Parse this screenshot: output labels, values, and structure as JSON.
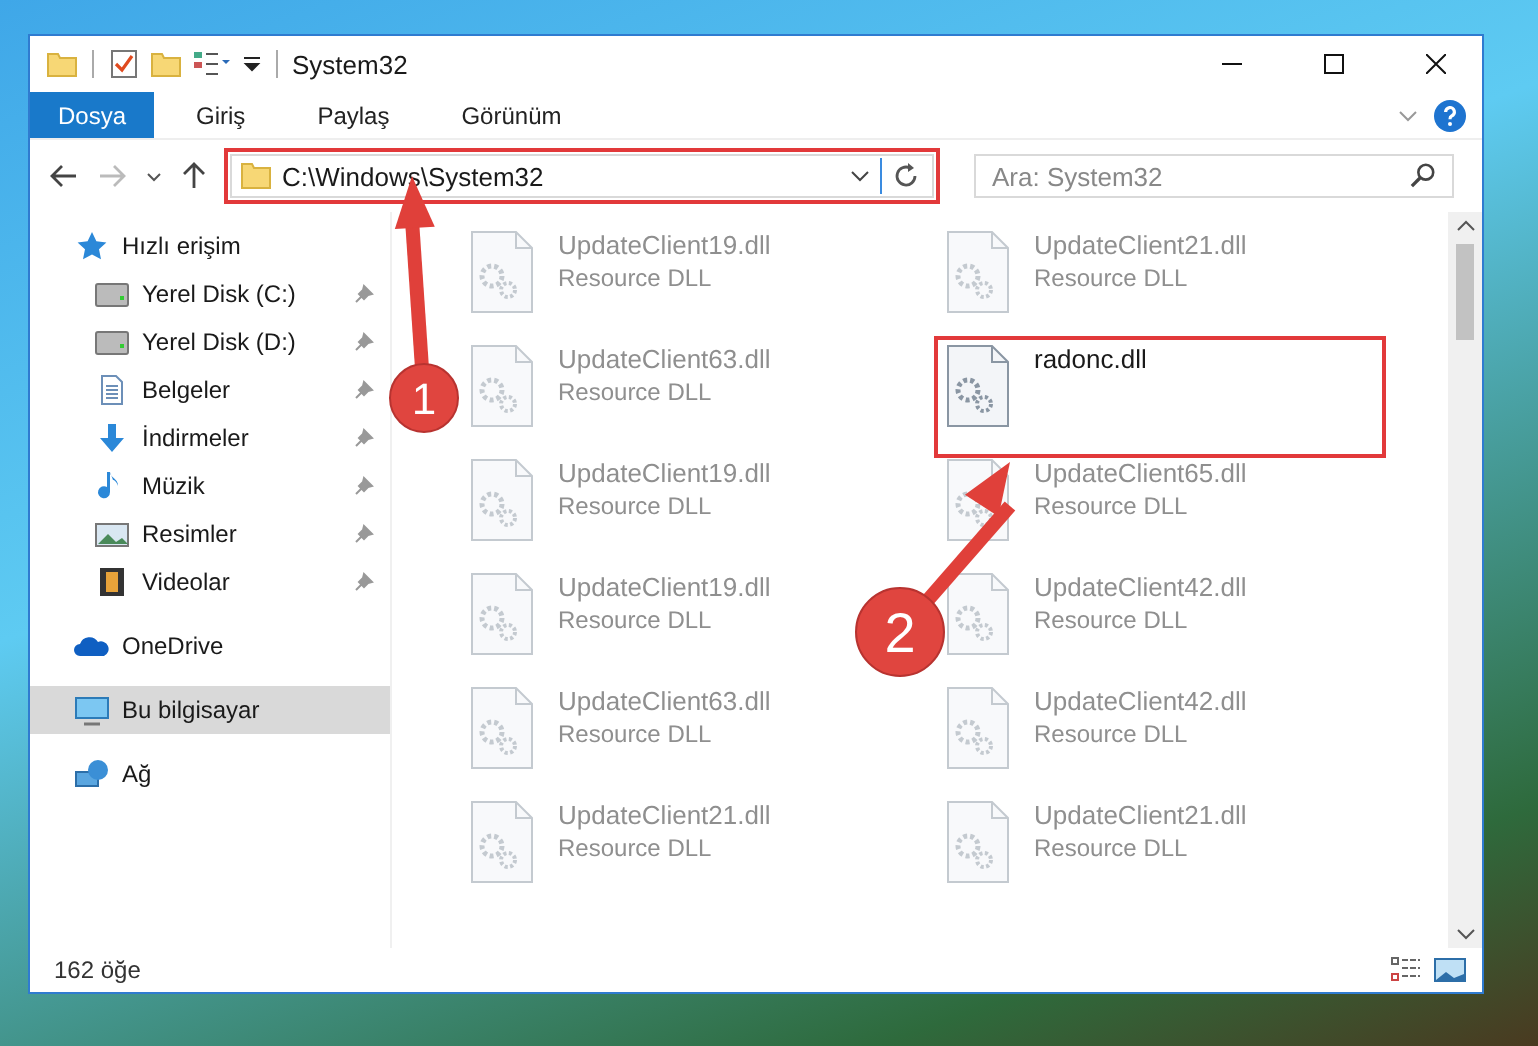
{
  "window": {
    "title": "System32"
  },
  "ribbon_tabs": [
    {
      "label": "Dosya",
      "selected": true
    },
    {
      "label": "Giriş",
      "selected": false
    },
    {
      "label": "Paylaş",
      "selected": false
    },
    {
      "label": "Görünüm",
      "selected": false
    }
  ],
  "address": {
    "value": "C:\\Windows\\System32",
    "highlighted": true
  },
  "search": {
    "placeholder": "Ara: System32"
  },
  "sidebar": {
    "items": [
      {
        "label": "Hızlı erişim",
        "kind": "star",
        "selected": false,
        "children": [
          {
            "label": "Yerel Disk (C:)",
            "kind": "drive",
            "pinned": true,
            "selected": false
          },
          {
            "label": "Yerel Disk (D:)",
            "kind": "drive",
            "pinned": true,
            "selected": false
          },
          {
            "label": "Belgeler",
            "kind": "doc",
            "pinned": true,
            "selected": false
          },
          {
            "label": "İndirmeler",
            "kind": "download",
            "pinned": true,
            "selected": false
          },
          {
            "label": "Müzik",
            "kind": "music",
            "pinned": true,
            "selected": false
          },
          {
            "label": "Resimler",
            "kind": "pictures",
            "pinned": true,
            "selected": false
          },
          {
            "label": "Videolar",
            "kind": "videos",
            "pinned": true,
            "selected": false
          }
        ]
      },
      {
        "label": "OneDrive",
        "kind": "cloud",
        "selected": false
      },
      {
        "label": "Bu bilgisayar",
        "kind": "pc",
        "selected": true
      },
      {
        "label": "Ağ",
        "kind": "network",
        "selected": false
      }
    ]
  },
  "files": [
    {
      "name": "UpdateClient19.dll",
      "type": "Resource DLL",
      "faded": true,
      "highlighted": false
    },
    {
      "name": "UpdateClient21.dll",
      "type": "Resource DLL",
      "faded": true,
      "highlighted": false
    },
    {
      "name": "UpdateClient63.dll",
      "type": "Resource DLL",
      "faded": true,
      "highlighted": false
    },
    {
      "name": "radonc.dll",
      "faded": false,
      "highlighted": true
    },
    {
      "name": "UpdateClient19.dll",
      "type": "Resource DLL",
      "faded": true,
      "highlighted": false
    },
    {
      "name": "UpdateClient65.dll",
      "type": "Resource DLL",
      "faded": true,
      "highlighted": false
    },
    {
      "name": "UpdateClient19.dll",
      "type": "Resource DLL",
      "faded": true,
      "highlighted": false
    },
    {
      "name": "UpdateClient42.dll",
      "type": "Resource DLL",
      "faded": true,
      "highlighted": false
    },
    {
      "name": "UpdateClient63.dll",
      "type": "Resource DLL",
      "faded": true,
      "highlighted": false
    },
    {
      "name": "UpdateClient42.dll",
      "type": "Resource DLL",
      "faded": true,
      "highlighted": false
    },
    {
      "name": "UpdateClient21.dll",
      "type": "Resource DLL",
      "faded": true,
      "highlighted": false
    },
    {
      "name": "UpdateClient21.dll",
      "type": "Resource DLL",
      "faded": true,
      "highlighted": false
    }
  ],
  "status_bar": {
    "count": "162 öğe"
  },
  "callouts": [
    {
      "number": "1"
    },
    {
      "number": "2"
    }
  ]
}
